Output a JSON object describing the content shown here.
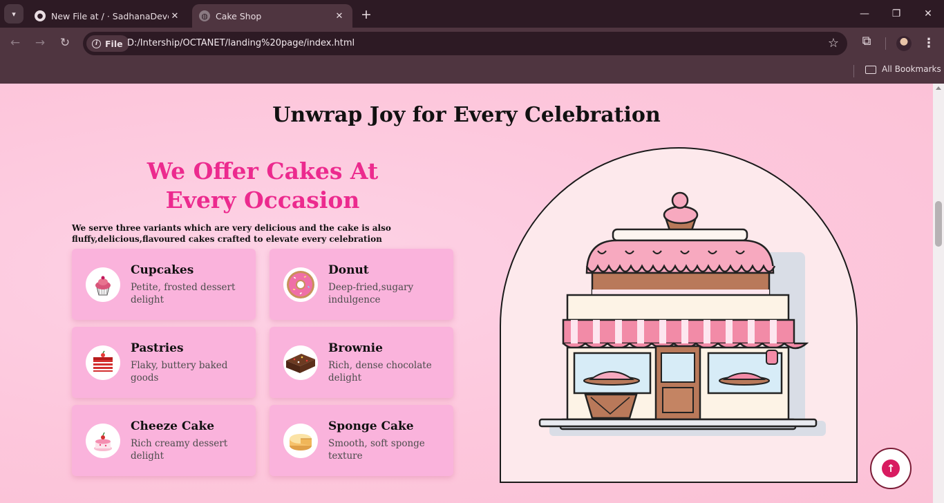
{
  "browser": {
    "tabs": [
      {
        "title": "New File at / · SadhanaDevelope",
        "icon": "github-icon",
        "active": false
      },
      {
        "title": "Cake Shop",
        "icon": "globe-icon",
        "active": true
      }
    ],
    "address": {
      "security_chip": "File",
      "url": "D:/Intership/OCTANET/landing%20page/index.html"
    },
    "bookmarks_label": "All Bookmarks"
  },
  "page": {
    "heading": "Unwrap Joy for Every Celebration",
    "offer_title": "We Offer Cakes At Every Occasion",
    "offer_description": "We serve three variants which are very delicious and the cake is also fluffy,delicious,flavoured cakes crafted to elevate every celebration",
    "cards": [
      {
        "title": "Cupcakes",
        "description": "Petite, frosted dessert delight",
        "icon": "cupcake-icon"
      },
      {
        "title": "Donut",
        "description": "Deep-fried,sugary indulgence",
        "icon": "donut-icon"
      },
      {
        "title": "Pastries",
        "description": "Flaky, buttery baked goods",
        "icon": "pastry-icon"
      },
      {
        "title": "Brownie",
        "description": "Rich, dense chocolate delight",
        "icon": "brownie-icon"
      },
      {
        "title": "Cheeze Cake",
        "description": "Rich creamy dessert delight",
        "icon": "cheesecake-icon"
      },
      {
        "title": "Sponge Cake",
        "description": "Smooth, soft sponge texture",
        "icon": "sponge-cake-icon"
      }
    ],
    "illustration": "cake-shop-illustration",
    "scroll_top_icon": "arrow-up-icon"
  },
  "colors": {
    "accent": "#ec2a8e",
    "card_bg": "#fab3dc",
    "page_bg": "#fdc7dc",
    "chrome_dark": "#2d1a24",
    "chrome_light": "#4f3540",
    "fab": "#d81b60"
  }
}
